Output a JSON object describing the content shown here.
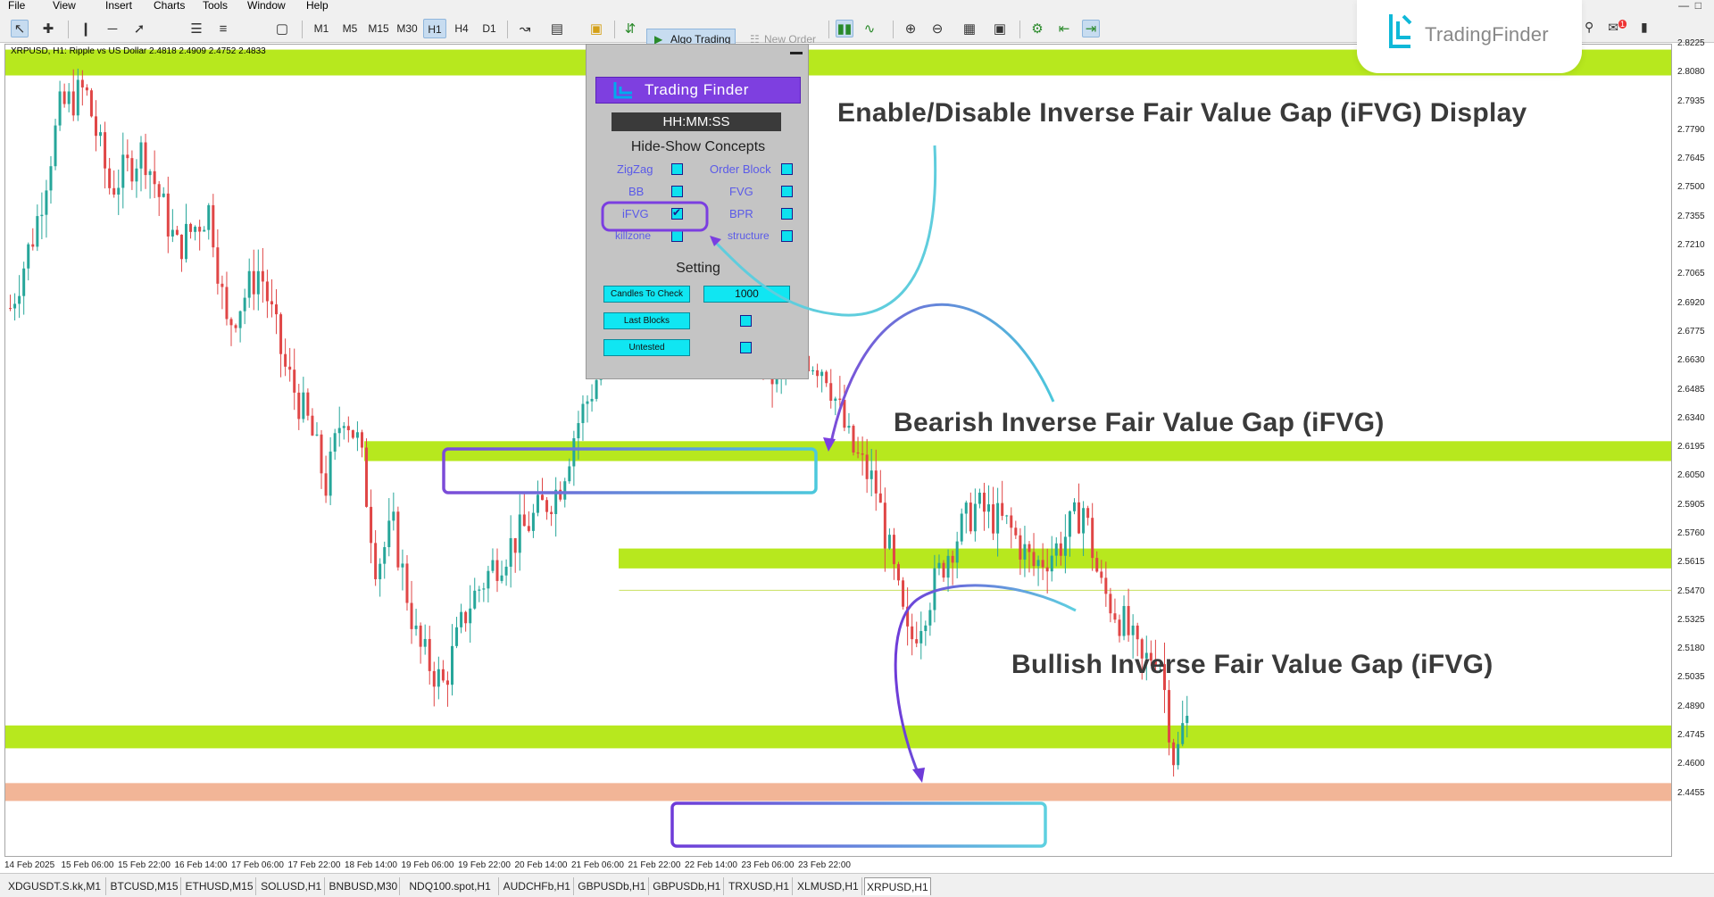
{
  "menu": [
    "File",
    "View",
    "Insert",
    "Charts",
    "Tools",
    "Window",
    "Help"
  ],
  "toolbar": {
    "timeframes": [
      "M1",
      "M5",
      "M15",
      "M30",
      "H1",
      "H4",
      "D1"
    ],
    "active_timeframe": "H1",
    "algo_trading": "Algo Trading",
    "new_order": "New Order"
  },
  "brand": {
    "name": "TradingFinder",
    "accent": "#0fb8d8"
  },
  "chart": {
    "symbol_line": "XRPUSD, H1:  Ripple vs US Dollar  2.4818 2.4909 2.4752 2.4833",
    "price_min": 2.431,
    "price_max": 2.816,
    "price_ticks": [
      "2.8225",
      "2.8080",
      "2.7935",
      "2.7790",
      "2.7645",
      "2.7500",
      "2.7355",
      "2.7210",
      "2.7065",
      "2.6920",
      "2.6775",
      "2.6630",
      "2.6485",
      "2.6340",
      "2.6195",
      "2.6050",
      "2.5905",
      "2.5760",
      "2.5615",
      "2.5470",
      "2.5325",
      "2.5180",
      "2.5035",
      "2.4890",
      "2.4745",
      "2.4600",
      "2.4455"
    ],
    "time_ticks": [
      "14 Feb 2025",
      "15 Feb 06:00",
      "15 Feb 22:00",
      "16 Feb 14:00",
      "17 Feb 06:00",
      "17 Feb 22:00",
      "18 Feb 14:00",
      "19 Feb 06:00",
      "19 Feb 22:00",
      "20 Feb 14:00",
      "21 Feb 06:00",
      "21 Feb 22:00",
      "22 Feb 14:00",
      "23 Feb 06:00",
      "23 Feb 22:00"
    ],
    "bull_color": "#26a69a",
    "bear_color": "#e04646",
    "zone_green": "#b7e81e",
    "zone_salmon": "#f2b597",
    "zones": [
      {
        "type": "green",
        "top": 2.82,
        "bottom": 2.807,
        "from": 0.0
      },
      {
        "type": "green",
        "top": 2.623,
        "bottom": 2.613,
        "from": 0.215
      },
      {
        "type": "green",
        "top": 2.569,
        "bottom": 2.559,
        "from": 0.368
      },
      {
        "type": "green",
        "top": 2.48,
        "bottom": 2.4685,
        "from": 0.0
      },
      {
        "type": "salmon",
        "top": 2.451,
        "bottom": 2.442,
        "from": 0.0
      }
    ],
    "hline": 2.548
  },
  "panel": {
    "brand": "Trading Finder",
    "timer": "HH:MM:SS",
    "concepts_title": "Hide-Show Concepts",
    "concepts": [
      {
        "label": "ZigZag",
        "checked": false
      },
      {
        "label": "Order Block",
        "checked": false
      },
      {
        "label": "BB",
        "checked": false
      },
      {
        "label": "FVG",
        "checked": false
      },
      {
        "label": "iFVG",
        "checked": true
      },
      {
        "label": "BPR",
        "checked": false
      },
      {
        "label": "killzone",
        "checked": false
      },
      {
        "label": "structure",
        "checked": false
      }
    ],
    "setting_title": "Setting",
    "candles_to_check_label": "Candles To Check",
    "candles_to_check_value": "1000",
    "last_blocks_label": "Last Blocks",
    "untested_label": "Untested"
  },
  "annotations": {
    "enable": "Enable/Disable Inverse Fair Value Gap (iFVG) Display",
    "bearish": "Bearish Inverse Fair Value Gap (iFVG)",
    "bullish": "Bullish Inverse Fair Value Gap (iFVG)"
  },
  "tabs": [
    "XDGUSDT.S.kk,M1",
    "BTCUSD,M15",
    "ETHUSD,M15",
    "SOLUSD,H1",
    "BNBUSD,M30",
    "NDQ100.spot,H1",
    "AUDCHFb,H1",
    "GBPUSDb,H1",
    "GBPUSDb,H1",
    "TRXUSD,H1",
    "XLMUSD,H1",
    "XRPUSD,H1"
  ],
  "active_tab": "XRPUSD,H1",
  "notification_count": "1"
}
